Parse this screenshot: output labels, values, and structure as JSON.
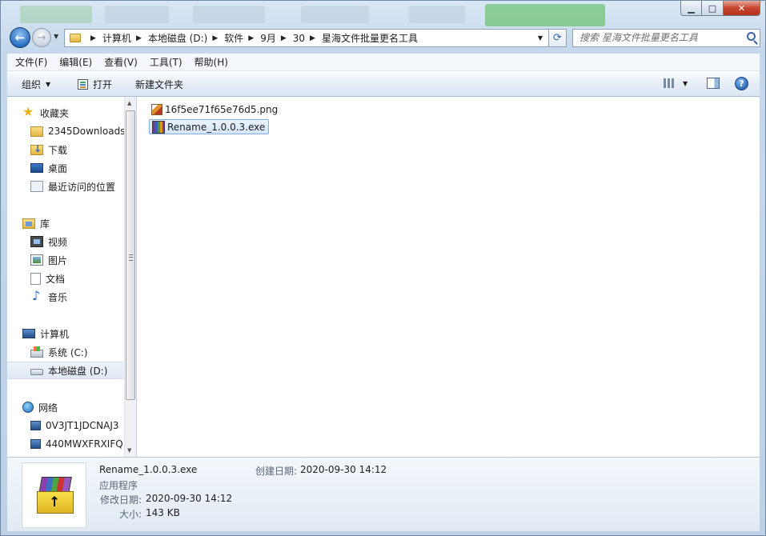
{
  "window": {
    "minimize_glyph": "▁",
    "maximize_glyph": "□",
    "close_glyph": "✕"
  },
  "address": {
    "crumbs": [
      "计算机",
      "本地磁盘 (D:)",
      "软件",
      "9月",
      "30",
      "星海文件批量更名工具"
    ]
  },
  "search": {
    "placeholder": "搜索 星海文件批量更名工具"
  },
  "menu": [
    "文件(F)",
    "编辑(E)",
    "查看(V)",
    "工具(T)",
    "帮助(H)"
  ],
  "toolbar": {
    "organize": "组织",
    "open": "打开",
    "new_folder": "新建文件夹",
    "help": "?"
  },
  "nav": {
    "favorites": "收藏夹",
    "fav_items": [
      "2345Downloads",
      "下载",
      "桌面",
      "最近访问的位置"
    ],
    "libraries": "库",
    "lib_items": [
      "视频",
      "图片",
      "文档",
      "音乐"
    ],
    "computer": "计算机",
    "drives": [
      "系统 (C:)",
      "本地磁盘 (D:)"
    ],
    "network": "网络",
    "network_items": [
      "0V3JT1JDCNAJ3",
      "440MWXFRXIFQ"
    ]
  },
  "files": [
    {
      "name": "16f5ee71f65e76d5.png",
      "icon": "png-icon"
    },
    {
      "name": "Rename_1.0.0.3.exe",
      "icon": "exe-icon"
    }
  ],
  "details": {
    "filename": "Rename_1.0.0.3.exe",
    "type": "应用程序",
    "modified_label": "修改日期:",
    "modified_value": "2020-09-30 14:12",
    "size_label": "大小:",
    "size_value": "143 KB",
    "created_label": "创建日期:",
    "created_value": "2020-09-30 14:12"
  },
  "colors": {
    "accent": "#2a6fc0",
    "selection_border": "#84acdd",
    "selection_fill": "#d3e5fa"
  }
}
